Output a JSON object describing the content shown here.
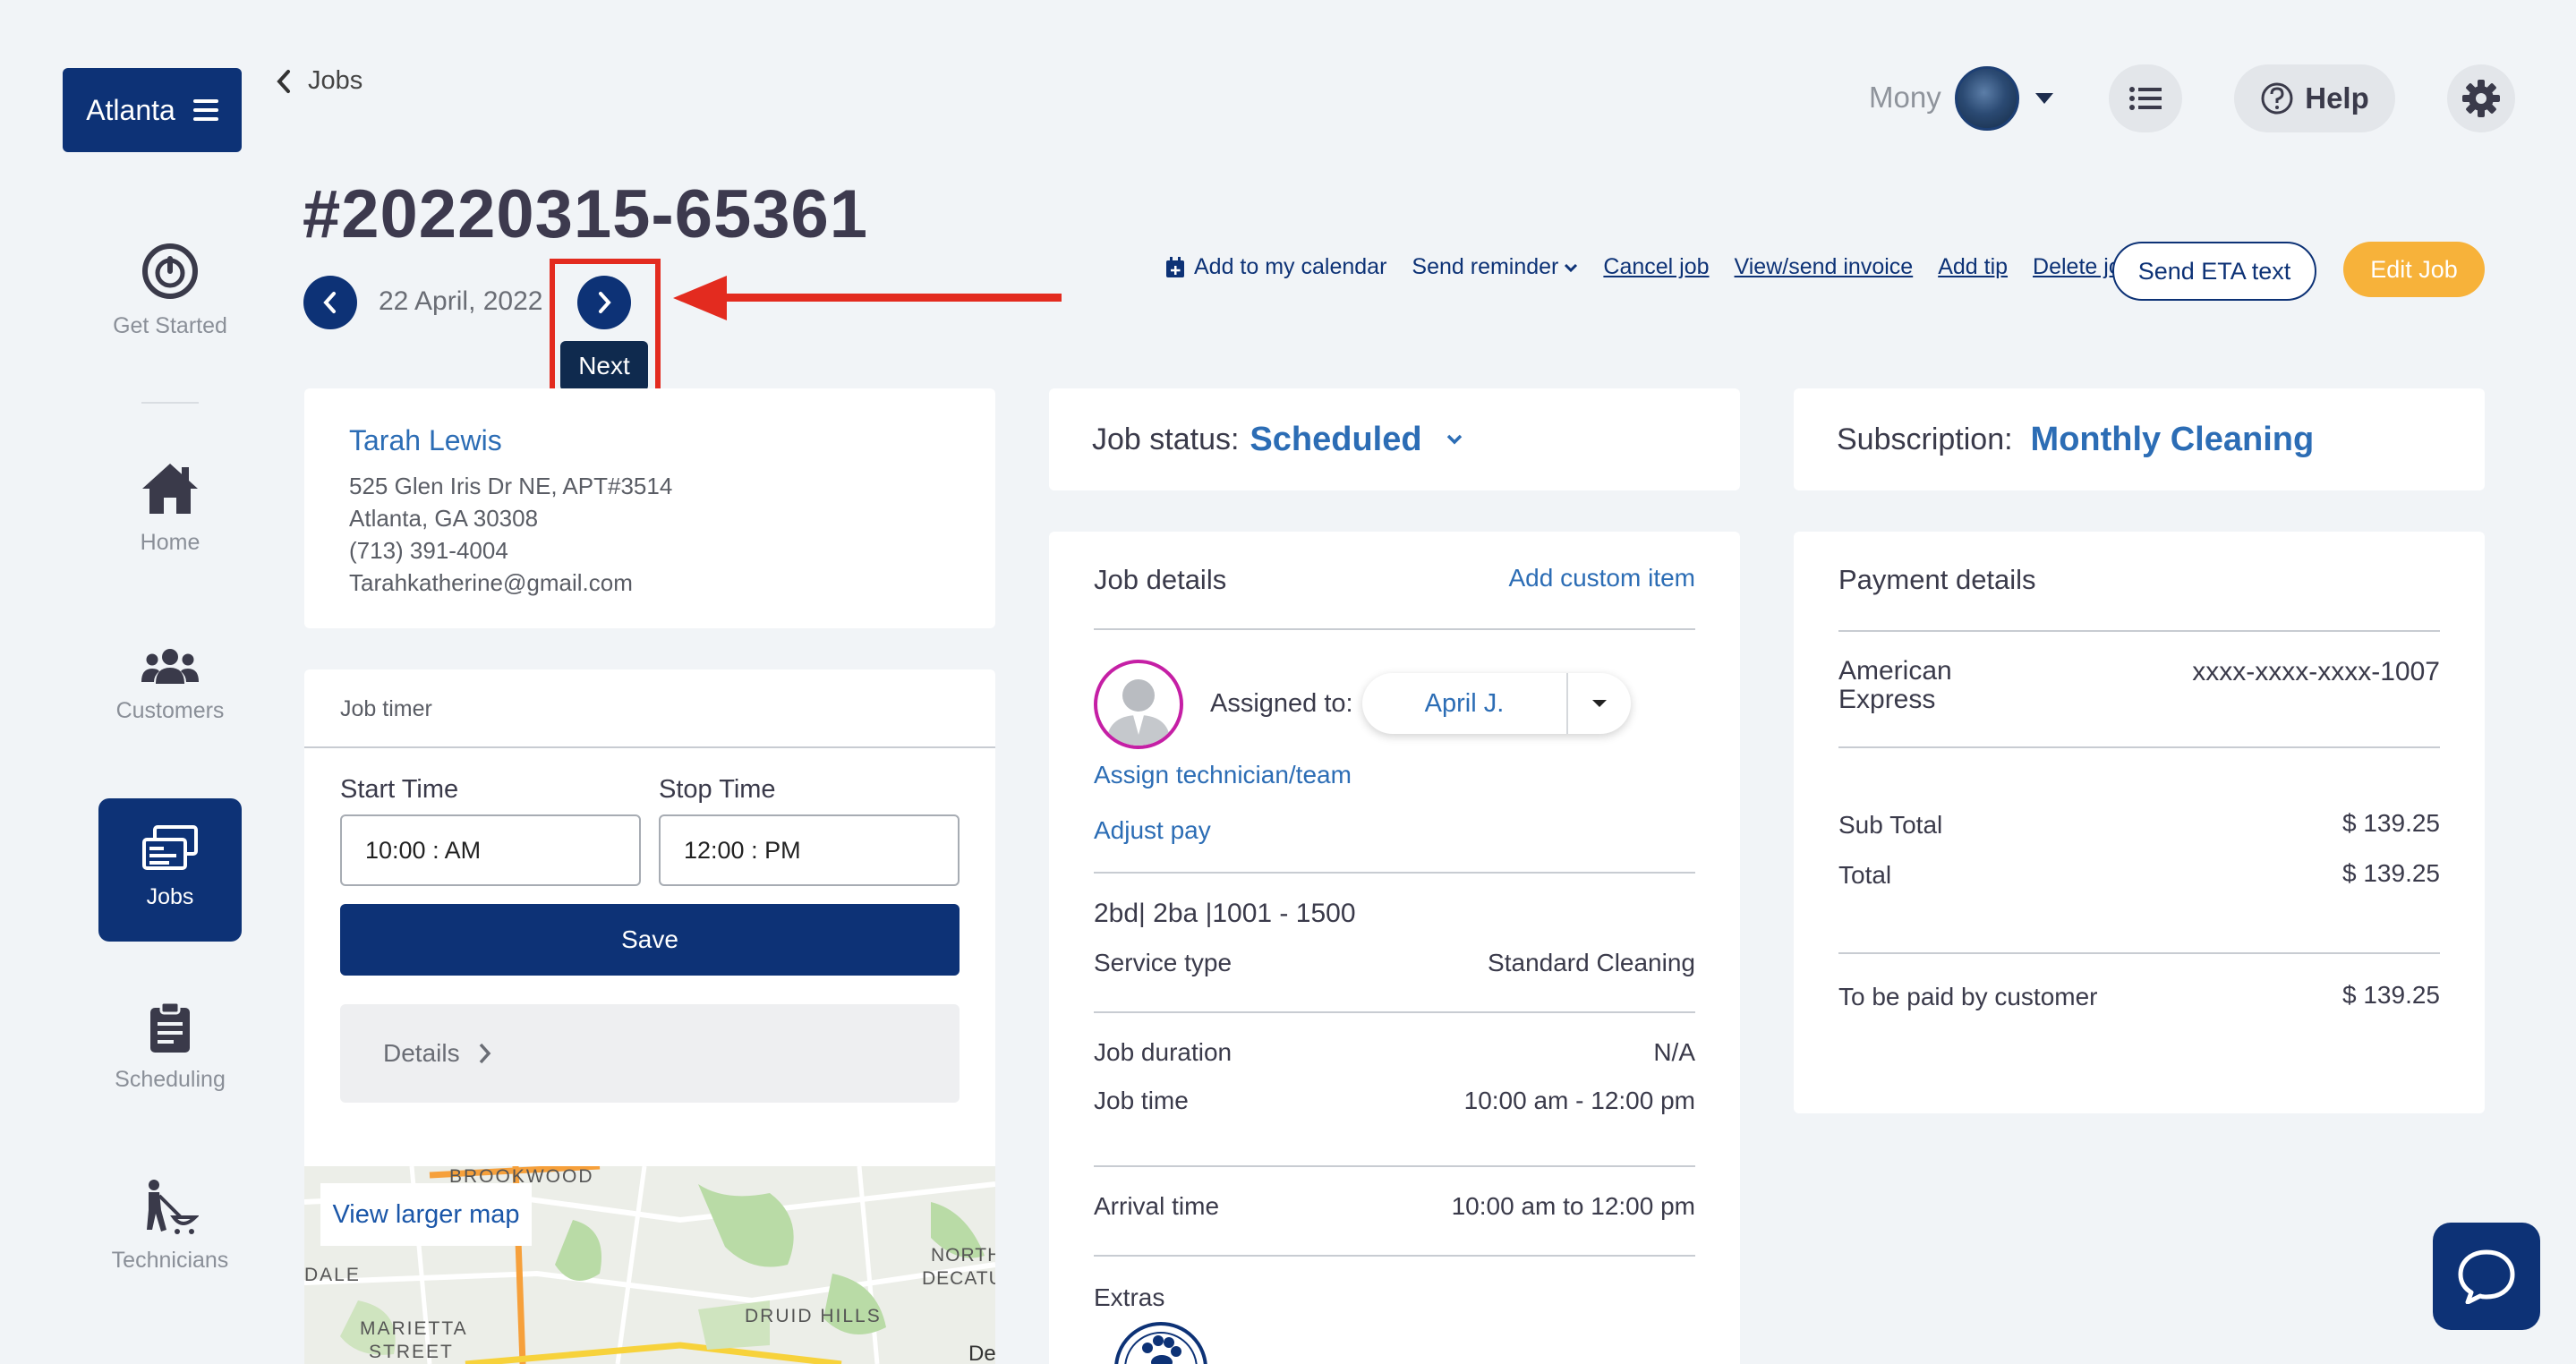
{
  "brand": {
    "label": "Atlanta"
  },
  "sidebar": {
    "items": [
      {
        "label": "Get Started",
        "icon": "power-icon"
      },
      {
        "label": "Home",
        "icon": "home-icon"
      },
      {
        "label": "Customers",
        "icon": "users-icon"
      },
      {
        "label": "Jobs",
        "icon": "jobs-icon",
        "active": true
      },
      {
        "label": "Scheduling",
        "icon": "clipboard-icon"
      },
      {
        "label": "Technicians",
        "icon": "technician-icon"
      }
    ]
  },
  "header": {
    "back_label": "Jobs",
    "job_id": "#20220315-65361",
    "date": "22 April, 2022",
    "next_tooltip": "Next",
    "user_name": "Mony",
    "help_label": "Help"
  },
  "actions": {
    "add_calendar": "Add to my calendar",
    "send_reminder": "Send reminder",
    "cancel_job": "Cancel job",
    "view_invoice": "View/send invoice",
    "add_tip": "Add tip",
    "delete_job": "Delete job",
    "send_eta": "Send ETA text",
    "edit_job": "Edit Job"
  },
  "customer": {
    "name": "Tarah Lewis",
    "address1": "525 Glen Iris Dr NE, APT#3514",
    "address2": "Atlanta, GA 30308",
    "phone": "(713) 391-4004",
    "email": "Tarahkatherine@gmail.com"
  },
  "timer": {
    "title": "Job timer",
    "start_label": "Start Time",
    "start_value": "10:00 : AM",
    "stop_label": "Stop Time",
    "stop_value": "12:00 : PM",
    "save_label": "Save",
    "details_label": "Details"
  },
  "map": {
    "link": "View larger map",
    "labels": [
      "BROOKWOOD",
      "NORTH",
      "DECATU",
      "DALE",
      "MARIETTA",
      "STREET",
      "DRUID HILLS",
      "De"
    ]
  },
  "job_status": {
    "label": "Job status:",
    "value": "Scheduled"
  },
  "subscription": {
    "label": "Subscription:",
    "value": "Monthly Cleaning"
  },
  "job_details": {
    "title": "Job details",
    "add_custom": "Add custom item",
    "assigned_label": "Assigned to:",
    "assigned_value": "April J.",
    "assign_link": "Assign technician/team",
    "adjust_pay": "Adjust pay",
    "property": "2bd| 2ba |1001 - 1500",
    "service_type_label": "Service type",
    "service_type_value": "Standard Cleaning",
    "duration_label": "Job duration",
    "duration_value": "N/A",
    "job_time_label": "Job time",
    "job_time_value": "10:00 am - 12:00 pm",
    "arrival_label": "Arrival time",
    "arrival_value": "10:00 am to 12:00 pm",
    "extras_label": "Extras"
  },
  "payment": {
    "title": "Payment details",
    "card_brand_line1": "American",
    "card_brand_line2": "Express",
    "card_number": "xxxx-xxxx-xxxx-1007",
    "subtotal_label": "Sub Total",
    "subtotal_value": "$ 139.25",
    "total_label": "Total",
    "total_value": "$ 139.25",
    "to_pay_label": "To be paid by customer",
    "to_pay_value": "$ 139.25"
  },
  "colors": {
    "primary": "#0d3276",
    "link": "#2c6db5",
    "accent": "#f7b23a",
    "annotation": "#e32b1f",
    "background": "#f1f4f7"
  }
}
